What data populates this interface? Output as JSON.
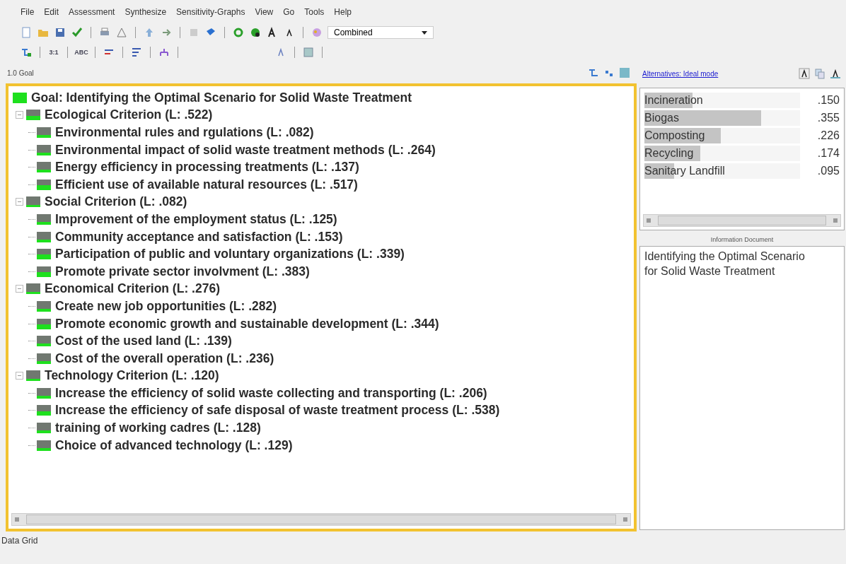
{
  "menu": [
    "File",
    "Edit",
    "Assessment",
    "Synthesize",
    "Sensitivity-Graphs",
    "View",
    "Go",
    "Tools",
    "Help"
  ],
  "toolbar": {
    "mode_dropdown": "Combined"
  },
  "toolbar2": {
    "ratio_label": "3:1",
    "text_label": "ABC"
  },
  "tree_header": "1.0 Goal",
  "tree": {
    "label": "Goal: Identifying the Optimal Scenario for Solid Waste Treatment",
    "kind": "full",
    "expanded": true,
    "children": [
      {
        "label": "Ecological Criterion (L: .522)",
        "kind": "half",
        "expanded": true,
        "children": [
          {
            "label": "Environmental rules and rgulations (L: .082)",
            "kind": "low"
          },
          {
            "label": "Environmental impact of solid waste treatment methods (L: .264)",
            "kind": "low"
          },
          {
            "label": "Energy efficiency in processing treatments (L: .137)",
            "kind": "low"
          },
          {
            "label": "Efficient use of available natural resources (L: .517)",
            "kind": "half"
          }
        ]
      },
      {
        "label": "Social Criterion (L: .082)",
        "kind": "low",
        "expanded": true,
        "children": [
          {
            "label": "Improvement of the employment status (L: .125)",
            "kind": "low"
          },
          {
            "label": "Community acceptance and satisfaction (L: .153)",
            "kind": "low"
          },
          {
            "label": "Participation of public and voluntary organizations (L: .339)",
            "kind": "half"
          },
          {
            "label": "Promote private sector involvment (L: .383)",
            "kind": "half"
          }
        ]
      },
      {
        "label": "Economical Criterion (L: .276)",
        "kind": "low",
        "expanded": true,
        "children": [
          {
            "label": "Create new job opportunities (L: .282)",
            "kind": "low"
          },
          {
            "label": "Promote economic growth and sustainable development (L: .344)",
            "kind": "half"
          },
          {
            "label": "Cost of the used land (L: .139)",
            "kind": "low"
          },
          {
            "label": "Cost of the overall operation (L: .236)",
            "kind": "low"
          }
        ]
      },
      {
        "label": "Technology Criterion (L: .120)",
        "kind": "low",
        "expanded": true,
        "children": [
          {
            "label": "Increase the efficiency of solid waste collecting and transporting (L: .206)",
            "kind": "low"
          },
          {
            "label": "Increase the efficiency of safe disposal of waste treatment process (L: .538)",
            "kind": "half"
          },
          {
            "label": "training of working cadres (L: .128)",
            "kind": "low"
          },
          {
            "label": "Choice of advanced technology (L: .129)",
            "kind": "low"
          }
        ]
      }
    ]
  },
  "alternatives": {
    "link": "Alternatives: Ideal mode",
    "items": [
      {
        "name": "Incineration",
        "value": ".150",
        "level": 0.31
      },
      {
        "name": "Biogas",
        "value": ".355",
        "level": 0.75
      },
      {
        "name": "Composting",
        "value": ".226",
        "level": 0.49
      },
      {
        "name": "Recycling",
        "value": ".174",
        "level": 0.36
      },
      {
        "name": "Sanitary Landfill",
        "value": ".095",
        "level": 0.19
      }
    ]
  },
  "information": {
    "title": "Information Document",
    "text": "Identifying the Optimal Scenario for Solid Waste Treatment"
  },
  "status_bar": "Data Grid"
}
